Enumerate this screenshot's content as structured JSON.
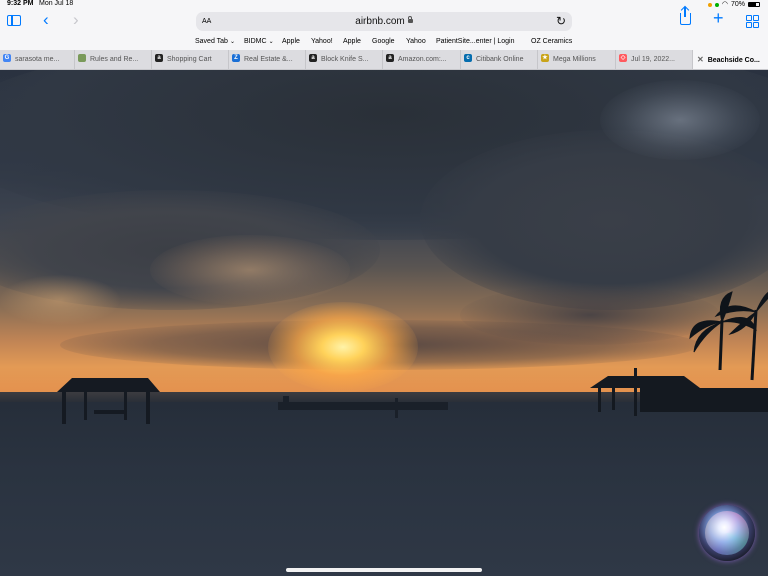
{
  "status_bar": {
    "time": "9:32 PM",
    "date": "Mon Jul 18",
    "battery_percent": "70%",
    "battery_level": 0.7
  },
  "toolbar": {
    "reader_label": "AA",
    "url": "airbnb.com",
    "icons": [
      "sidebar-icon",
      "back-icon",
      "forward-icon",
      "lock-icon",
      "reload-icon",
      "share-icon",
      "plus-icon",
      "tabs-icon"
    ]
  },
  "bookmarks": [
    {
      "label": "Saved Tab",
      "has_menu": true
    },
    {
      "label": "BIDMC",
      "has_menu": true
    },
    {
      "label": "Apple",
      "has_menu": false
    },
    {
      "label": "Yahoo!",
      "has_menu": false
    },
    {
      "label": "Apple",
      "has_menu": false
    },
    {
      "label": "Google",
      "has_menu": false
    },
    {
      "label": "Yahoo",
      "has_menu": false
    },
    {
      "label": "PatientSite...enter | Login",
      "has_menu": false
    },
    {
      "label": "OZ Ceramics",
      "has_menu": false
    }
  ],
  "tabs": [
    {
      "label": "sarasota me...",
      "favicon": "G",
      "favicon_color": "#4285f4",
      "active": false
    },
    {
      "label": "Rules and Re...",
      "favicon": "",
      "favicon_color": "#7a9a5a",
      "active": false
    },
    {
      "label": "Shopping Cart",
      "favicon": "a",
      "favicon_color": "#222222",
      "active": false
    },
    {
      "label": "Real Estate &...",
      "favicon": "Z",
      "favicon_color": "#1a6fd6",
      "active": false
    },
    {
      "label": "Block Knife S...",
      "favicon": "a",
      "favicon_color": "#222222",
      "active": false
    },
    {
      "label": "Amazon.com:...",
      "favicon": "a",
      "favicon_color": "#222222",
      "active": false
    },
    {
      "label": "Citibank Online",
      "favicon": "c",
      "favicon_color": "#056dae",
      "active": false
    },
    {
      "label": "Mega Millions",
      "favicon": "★",
      "favicon_color": "#c9a41a",
      "active": false
    },
    {
      "label": "Jul 19, 2022...",
      "favicon": "◇",
      "favicon_color": "#ff5a5f",
      "active": false
    },
    {
      "label": "Beachside Co...",
      "favicon": "",
      "favicon_color": "",
      "active": true
    }
  ],
  "colors": {
    "accent": "#007aff",
    "chrome_bg": "#f6f6f8",
    "tab_strip_bg": "#dcdce0"
  }
}
